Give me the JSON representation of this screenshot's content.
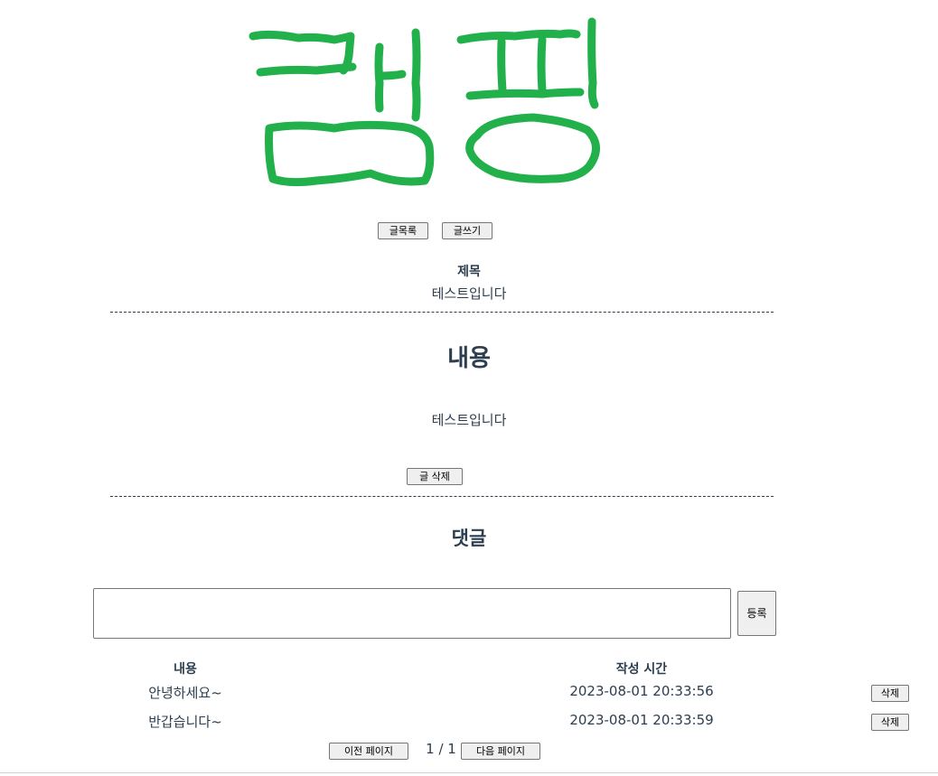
{
  "header": {
    "logo_text": "캠핑",
    "logo_color": "#22b04b"
  },
  "nav": {
    "list_label": "글목록",
    "write_label": "글쓰기"
  },
  "post": {
    "title_label": "제목",
    "title_value": "테스트입니다",
    "content_heading": "내용",
    "content_value": "테스트입니다",
    "delete_label": "글 삭제"
  },
  "comments": {
    "heading": "댓글",
    "input_value": "",
    "register_label": "등록",
    "col_content": "내용",
    "col_time": "작성 시간",
    "rows": [
      {
        "content": "안녕하세요~",
        "time": "2023-08-01 20:33:56",
        "delete_label": "삭제"
      },
      {
        "content": "반갑습니다~",
        "time": "2023-08-01 20:33:59",
        "delete_label": "삭제"
      }
    ]
  },
  "pagination": {
    "prev_label": "이전 페이지",
    "page_info": "1 / 1",
    "next_label": "다음 페이지"
  }
}
